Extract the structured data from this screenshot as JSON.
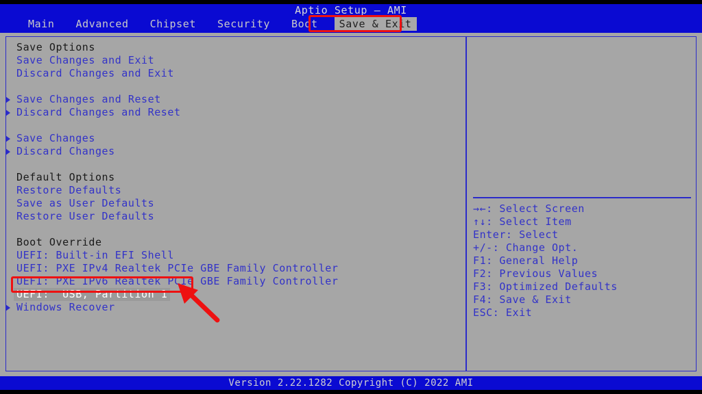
{
  "window": {
    "title": "Aptio Setup – AMI",
    "version_bar": "Version 2.22.1282 Copyright (C) 2022 AMI"
  },
  "menubar": {
    "items": [
      {
        "label": "Main",
        "active": false
      },
      {
        "label": "Advanced",
        "active": false
      },
      {
        "label": "Chipset",
        "active": false
      },
      {
        "label": "Security",
        "active": false
      },
      {
        "label": "Boot",
        "active": false
      },
      {
        "label": "Save & Exit",
        "active": true
      }
    ]
  },
  "main_panel": {
    "rows": [
      {
        "label": "Save Options",
        "type": "section-header",
        "arrow": false,
        "selected": false
      },
      {
        "label": "Save Changes and Exit",
        "type": "item",
        "arrow": false,
        "selected": false
      },
      {
        "label": "Discard Changes and Exit",
        "type": "item",
        "arrow": false,
        "selected": false
      },
      {
        "label": "",
        "type": "spacer",
        "arrow": false,
        "selected": false
      },
      {
        "label": "Save Changes and Reset",
        "type": "item",
        "arrow": true,
        "selected": false
      },
      {
        "label": "Discard Changes and Reset",
        "type": "item",
        "arrow": true,
        "selected": false
      },
      {
        "label": "",
        "type": "spacer",
        "arrow": false,
        "selected": false
      },
      {
        "label": "Save Changes",
        "type": "item",
        "arrow": true,
        "selected": false
      },
      {
        "label": "Discard Changes",
        "type": "item",
        "arrow": true,
        "selected": false
      },
      {
        "label": "",
        "type": "spacer",
        "arrow": false,
        "selected": false
      },
      {
        "label": "Default Options",
        "type": "section-header",
        "arrow": false,
        "selected": false
      },
      {
        "label": "Restore Defaults",
        "type": "item",
        "arrow": false,
        "selected": false
      },
      {
        "label": "Save as User Defaults",
        "type": "item",
        "arrow": false,
        "selected": false
      },
      {
        "label": "Restore User Defaults",
        "type": "item",
        "arrow": false,
        "selected": false
      },
      {
        "label": "",
        "type": "spacer",
        "arrow": false,
        "selected": false
      },
      {
        "label": "Boot Override",
        "type": "section-header",
        "arrow": false,
        "selected": false
      },
      {
        "label": "UEFI: Built-in EFI Shell",
        "type": "item",
        "arrow": false,
        "selected": false
      },
      {
        "label": "UEFI: PXE IPv4 Realtek PCIe GBE Family Controller",
        "type": "item",
        "arrow": false,
        "selected": false
      },
      {
        "label": "UEFI: PXE IPv6 Realtek PCIe GBE Family Controller",
        "type": "item",
        "arrow": false,
        "selected": false
      },
      {
        "label": "UEFI:  USB, Partition 1",
        "type": "item",
        "arrow": false,
        "selected": true
      },
      {
        "label": "Windows Recover",
        "type": "item",
        "arrow": true,
        "selected": false
      }
    ]
  },
  "help_panel": {
    "keys": [
      {
        "key": "→←",
        "text": ": Select Screen"
      },
      {
        "key": "↑↓",
        "text": ": Select Item"
      },
      {
        "key": "Enter",
        "text": ": Select"
      },
      {
        "key": "+/-",
        "text": ": Change Opt."
      },
      {
        "key": "F1",
        "text": ": General Help"
      },
      {
        "key": "F2",
        "text": ": Previous Values"
      },
      {
        "key": "F3",
        "text": ": Optimized Defaults"
      },
      {
        "key": "F4",
        "text": ": Save & Exit"
      },
      {
        "key": "ESC",
        "text": ": Exit"
      }
    ]
  },
  "annotations": {
    "tab_highlight_label": "Save & Exit",
    "boot_entry_highlight_label": "UEFI:  USB, Partition 1",
    "arrow_color": "#ee1111",
    "box_color": "#ee1111"
  },
  "colors": {
    "header_blue": "#0a0ad2",
    "panel_grey": "#a6a6a6",
    "text_blue": "#3232c8",
    "text_dark": "#1a1a1a",
    "selection_bg": "#9a9a9a",
    "selection_fg": "#ffffff"
  }
}
